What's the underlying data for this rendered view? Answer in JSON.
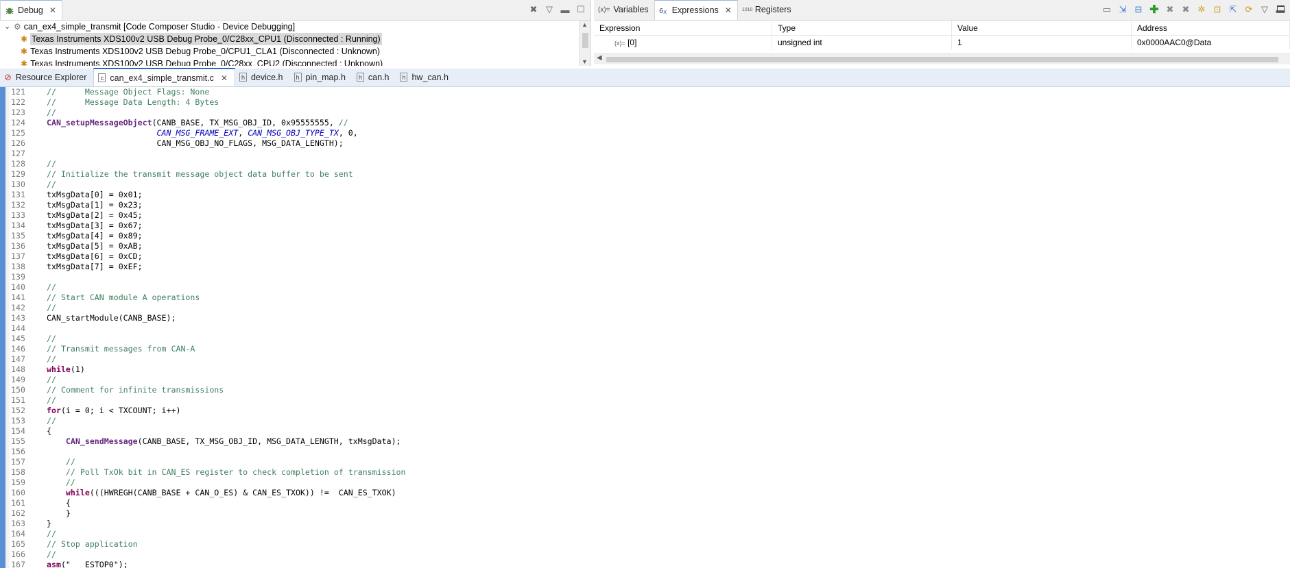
{
  "debug_view": {
    "tab_label": "Debug",
    "tree": [
      {
        "label": "can_ex4_simple_transmit [Code Composer Studio - Device Debugging]",
        "indent": 0,
        "selected": false
      },
      {
        "label": "Texas Instruments XDS100v2 USB Debug Probe_0/C28xx_CPU1 (Disconnected : Running)",
        "indent": 1,
        "selected": true
      },
      {
        "label": "Texas Instruments XDS100v2 USB Debug Probe_0/CPU1_CLA1 (Disconnected : Unknown)",
        "indent": 1,
        "selected": false
      },
      {
        "label": "Texas Instruments XDS100v2 USB Debug Probe_0/C28xx_CPU2 (Disconnected : Unknown)",
        "indent": 1,
        "selected": false
      }
    ]
  },
  "expressions_view": {
    "tabs": [
      {
        "label": "Variables",
        "icon": "(x)="
      },
      {
        "label": "Expressions",
        "icon": "expressions-icon"
      },
      {
        "label": "Registers",
        "icon": "1010"
      }
    ],
    "columns": [
      "Expression",
      "Type",
      "Value",
      "Address"
    ],
    "rows": [
      {
        "expression": "[0]",
        "type": "unsigned int",
        "value": "1",
        "address": "0x0000AAC0@Data"
      }
    ]
  },
  "editor_tabs": [
    {
      "label": "Resource Explorer",
      "active": false
    },
    {
      "label": "can_ex4_simple_transmit.c",
      "active": true
    },
    {
      "label": "device.h",
      "active": false
    },
    {
      "label": "pin_map.h",
      "active": false
    },
    {
      "label": "can.h",
      "active": false
    },
    {
      "label": "hw_can.h",
      "active": false
    }
  ],
  "code_lines": [
    {
      "n": "121",
      "html": "<span class=\"c\">//      Message Object Flags: None</span>"
    },
    {
      "n": "122",
      "html": "<span class=\"c\">//      Message Data Length: 4 Bytes</span>"
    },
    {
      "n": "123",
      "html": "<span class=\"c\">//</span>"
    },
    {
      "n": "124",
      "html": "<span class=\"fn\">CAN_setupMessageObject</span>(CANB_BASE, TX_MSG_OBJ_ID, 0x95555555, <span class=\"c\">//</span>"
    },
    {
      "n": "125",
      "html": "                       <span class=\"it\">CAN_MSG_FRAME_EXT</span>, <span class=\"it\">CAN_MSG_OBJ_TYPE_TX</span>, 0,"
    },
    {
      "n": "126",
      "html": "                       CAN_MSG_OBJ_NO_FLAGS, MSG_DATA_LENGTH);"
    },
    {
      "n": "127",
      "html": ""
    },
    {
      "n": "128",
      "html": "<span class=\"c\">//</span>"
    },
    {
      "n": "129",
      "html": "<span class=\"c\">// Initialize the transmit message object data buffer to be sent</span>"
    },
    {
      "n": "130",
      "html": "<span class=\"c\">//</span>"
    },
    {
      "n": "131",
      "html": "txMsgData[0] = 0x01;"
    },
    {
      "n": "132",
      "html": "txMsgData[1] = 0x23;"
    },
    {
      "n": "133",
      "html": "txMsgData[2] = 0x45;"
    },
    {
      "n": "134",
      "html": "txMsgData[3] = 0x67;"
    },
    {
      "n": "135",
      "html": "txMsgData[4] = 0x89;"
    },
    {
      "n": "136",
      "html": "txMsgData[5] = 0xAB;"
    },
    {
      "n": "137",
      "html": "txMsgData[6] = 0xCD;"
    },
    {
      "n": "138",
      "html": "txMsgData[7] = 0xEF;"
    },
    {
      "n": "139",
      "html": ""
    },
    {
      "n": "140",
      "html": "<span class=\"c\">//</span>"
    },
    {
      "n": "141",
      "html": "<span class=\"c\">// Start CAN module A operations</span>"
    },
    {
      "n": "142",
      "html": "<span class=\"c\">//</span>"
    },
    {
      "n": "143",
      "html": "CAN_startModule(CANB_BASE);"
    },
    {
      "n": "144",
      "html": ""
    },
    {
      "n": "145",
      "html": "<span class=\"c\">//</span>"
    },
    {
      "n": "146",
      "html": "<span class=\"c\">// Transmit messages from CAN-A</span>"
    },
    {
      "n": "147",
      "html": "<span class=\"c\">//</span>"
    },
    {
      "n": "148",
      "html": "<span class=\"k\">while</span>(1)"
    },
    {
      "n": "149",
      "html": "<span class=\"c\">//</span>"
    },
    {
      "n": "150",
      "html": "<span class=\"c\">// Comment for infinite transmissions</span>"
    },
    {
      "n": "151",
      "html": "<span class=\"c\">//</span>"
    },
    {
      "n": "152",
      "html": "<span class=\"k\">for</span>(i = 0; i &lt; TXCOUNT; i++)"
    },
    {
      "n": "153",
      "html": "<span class=\"c\">//</span>"
    },
    {
      "n": "154",
      "html": "{"
    },
    {
      "n": "155",
      "html": "    <span class=\"fn\">CAN_sendMessage</span>(CANB_BASE, TX_MSG_OBJ_ID, MSG_DATA_LENGTH, txMsgData);"
    },
    {
      "n": "156",
      "html": ""
    },
    {
      "n": "157",
      "html": "    <span class=\"c\">//</span>"
    },
    {
      "n": "158",
      "html": "    <span class=\"c\">// Poll TxOk bit in CAN_ES register to check completion of transmission</span>"
    },
    {
      "n": "159",
      "html": "    <span class=\"c\">//</span>"
    },
    {
      "n": "160",
      "html": "    <span class=\"k\">while</span>(((HWREGH(CANB_BASE + CAN_O_ES) &amp; CAN_ES_TXOK)) !=  CAN_ES_TXOK)"
    },
    {
      "n": "161",
      "html": "    {"
    },
    {
      "n": "162",
      "html": "    }"
    },
    {
      "n": "163",
      "html": "}"
    },
    {
      "n": "164",
      "html": "<span class=\"c\">//</span>"
    },
    {
      "n": "165",
      "html": "<span class=\"c\">// Stop application</span>"
    },
    {
      "n": "166",
      "html": "<span class=\"c\">//</span>"
    },
    {
      "n": "167",
      "html": "<span class=\"k sq\">asm</span><span class=\"sq\">(\"   ESTOP0\");</span>"
    }
  ],
  "colors": {
    "accent": "#2b66c1",
    "comment": "#3f7f5f",
    "keyword": "#7f0055",
    "gutter": "#5a8fd6"
  }
}
